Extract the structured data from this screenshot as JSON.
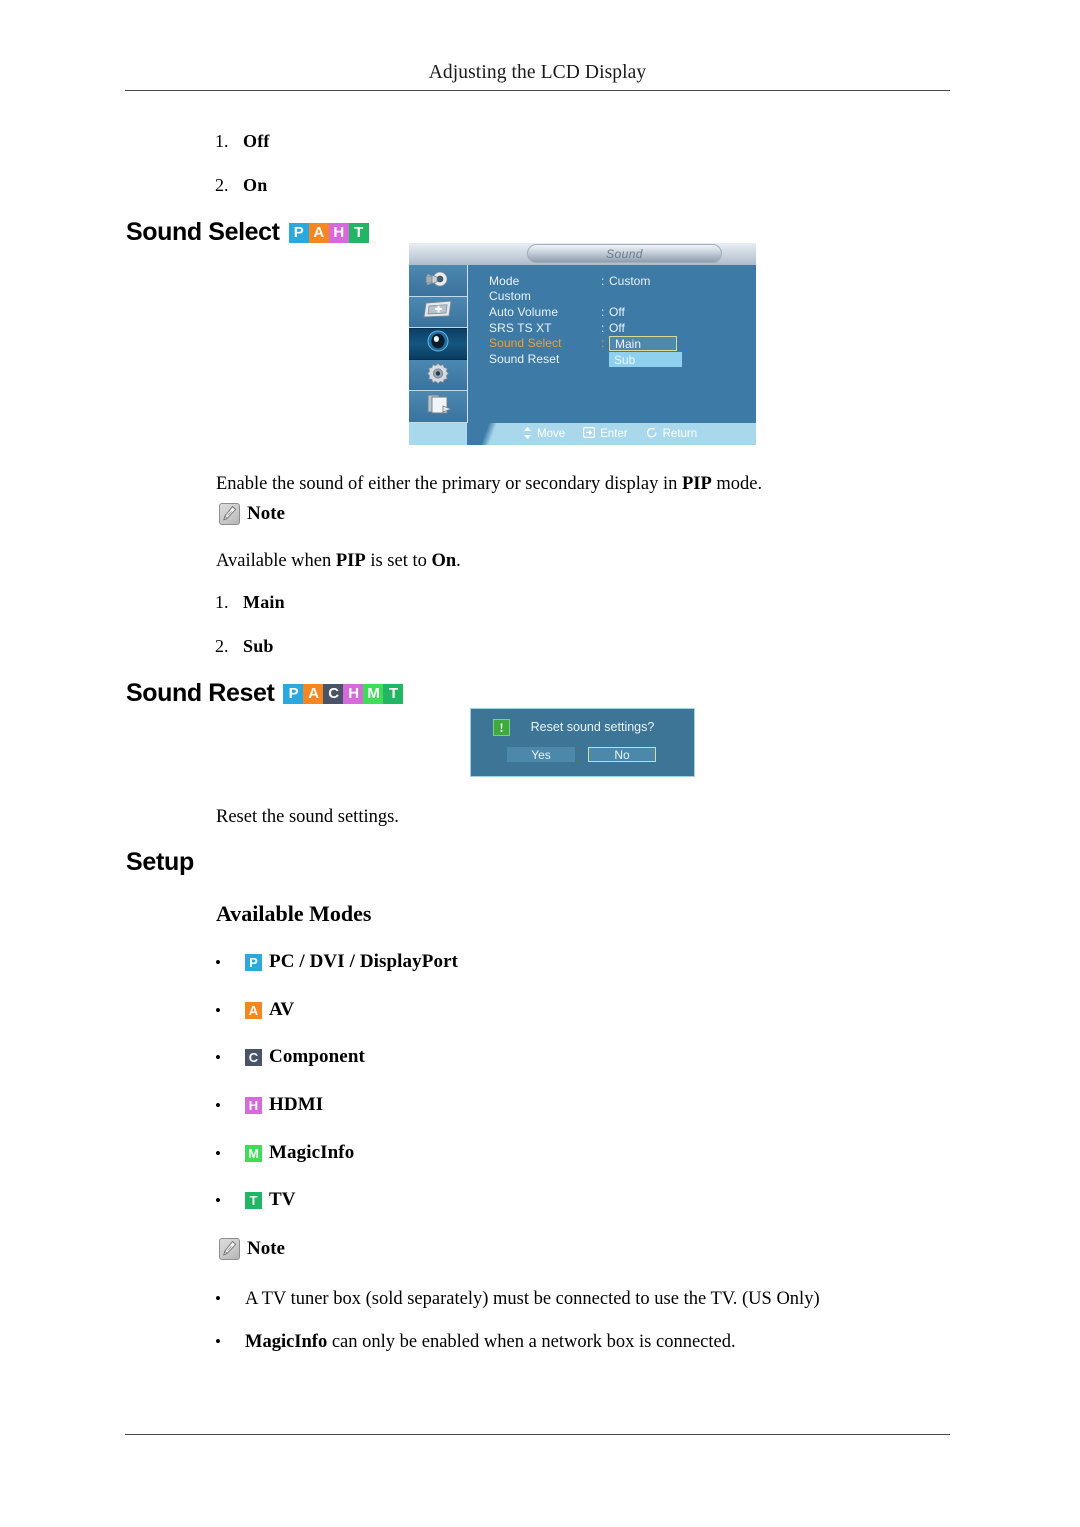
{
  "page": {
    "header_title": "Adjusting the LCD Display"
  },
  "pip_options": [
    {
      "num": "1.",
      "label": "Off"
    },
    {
      "num": "2.",
      "label": "On"
    }
  ],
  "sound_select": {
    "heading": "Sound Select",
    "badges": [
      {
        "letter": "P",
        "color": "#29a9dd"
      },
      {
        "letter": "A",
        "color": "#f6861f"
      },
      {
        "letter": "H",
        "color": "#d66ada"
      },
      {
        "letter": "T",
        "color": "#22b563"
      }
    ],
    "description_pre": "Enable the sound of either the primary or secondary display in ",
    "description_bold": "PIP",
    "description_post": " mode.",
    "note_label": "Note",
    "availability_pre": "Available when ",
    "availability_bold1": "PIP",
    "availability_mid": " is set to ",
    "availability_bold2": "On",
    "availability_post": ".",
    "options": [
      {
        "num": "1.",
        "label": "Main"
      },
      {
        "num": "2.",
        "label": "Sub"
      }
    ]
  },
  "osd": {
    "title": "Sound",
    "sidebar_icons": [
      "picture-icon",
      "screen-icon",
      "sound-icon",
      "setup-icon",
      "multi-control-icon"
    ],
    "active_sidebar_index": 2,
    "rows": [
      {
        "label": "Mode",
        "colon": ":",
        "value": "Custom",
        "highlighted": false
      },
      {
        "label": "Custom",
        "colon": "",
        "value": "",
        "highlighted": false
      },
      {
        "label": "Auto Volume",
        "colon": ":",
        "value": "Off",
        "highlighted": false
      },
      {
        "label": "SRS TS XT",
        "colon": ":",
        "value": "Off",
        "highlighted": false
      },
      {
        "label": "Sound Select",
        "colon": ":",
        "value": "",
        "highlighted": true
      },
      {
        "label": "Sound Reset",
        "colon": "",
        "value": "",
        "highlighted": false
      }
    ],
    "dropdown": {
      "selected": "Main",
      "other": "Sub"
    },
    "footer": [
      {
        "icon": "updown-arrow-icon",
        "label": "Move"
      },
      {
        "icon": "enter-icon",
        "label": "Enter"
      },
      {
        "icon": "return-icon",
        "label": "Return"
      }
    ]
  },
  "sound_reset": {
    "heading": "Sound Reset",
    "badges": [
      {
        "letter": "P",
        "color": "#29a9dd"
      },
      {
        "letter": "A",
        "color": "#f6861f"
      },
      {
        "letter": "C",
        "color": "#4a5468"
      },
      {
        "letter": "H",
        "color": "#d66ada"
      },
      {
        "letter": "M",
        "color": "#3ddd5a"
      },
      {
        "letter": "T",
        "color": "#22b563"
      }
    ],
    "dialog": {
      "icon": "info-icon",
      "icon_glyph": "!",
      "question": "Reset sound settings?",
      "yes_label": "Yes",
      "no_label": "No",
      "selected": "No"
    },
    "description": "Reset the sound settings."
  },
  "setup": {
    "heading": "Setup",
    "available_modes_heading": "Available Modes",
    "modes": [
      {
        "badge": "P",
        "color": "#29a9dd",
        "label": "PC / DVI / DisplayPort"
      },
      {
        "badge": "A",
        "color": "#f6861f",
        "label": "AV"
      },
      {
        "badge": "C",
        "color": "#4a5468",
        "label": "Component"
      },
      {
        "badge": "H",
        "color": "#d66ada",
        "label": "HDMI"
      },
      {
        "badge": "M",
        "color": "#3ddd5a",
        "label": "MagicInfo"
      },
      {
        "badge": "T",
        "color": "#22b563",
        "label": "TV"
      }
    ],
    "note_label": "Note",
    "notes": [
      {
        "bold": "",
        "text": "A TV tuner box (sold separately) must be connected to use the TV. (US Only)"
      },
      {
        "bold": "MagicInfo",
        "text": " can only be enabled when a network box is connected."
      }
    ]
  }
}
